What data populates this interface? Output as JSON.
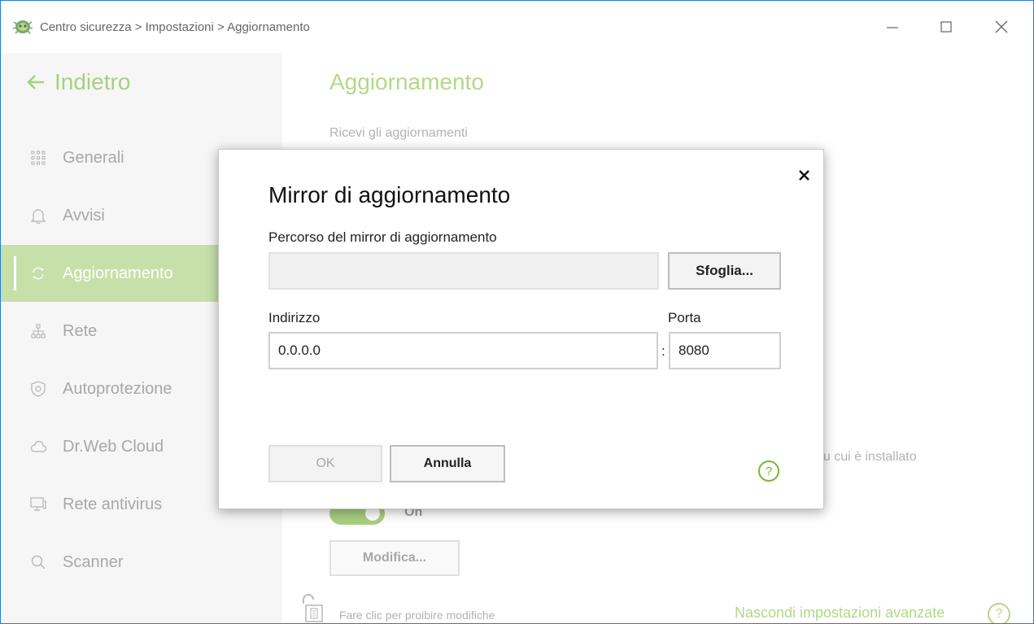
{
  "window": {
    "title": "Centro sicurezza > Impostazioni > Aggiornamento",
    "accent": "#8bc34a"
  },
  "sidebar": {
    "back_label": "Indietro",
    "items": [
      {
        "label": "Generali",
        "icon": "grid-icon"
      },
      {
        "label": "Avvisi",
        "icon": "bell-icon"
      },
      {
        "label": "Aggiornamento",
        "icon": "refresh-icon",
        "active": true
      },
      {
        "label": "Rete",
        "icon": "network-icon"
      },
      {
        "label": "Autoprotezione",
        "icon": "shield-icon"
      },
      {
        "label": "Dr.Web Cloud",
        "icon": "cloud-icon"
      },
      {
        "label": "Rete antivirus",
        "icon": "monitor-icon"
      },
      {
        "label": "Scanner",
        "icon": "search-icon"
      }
    ]
  },
  "main": {
    "title": "Aggiornamento",
    "receive_label": "Ricevi gli aggiornamenti",
    "obscured_text": "le su cui è installato",
    "toggle_label": "On",
    "modify_label": "Modifica...",
    "lock_text": "Fare clic per proibire modifiche",
    "hide_advanced": "Nascondi impostazioni avanzate",
    "help_glyph": "?"
  },
  "dialog": {
    "title": "Mirror di aggiornamento",
    "close_glyph": "×",
    "path_label": "Percorso del mirror di aggiornamento",
    "path_value": "",
    "browse_label": "Sfoglia...",
    "address_label": "Indirizzo",
    "address_value": "0.0.0.0",
    "port_label": "Porta",
    "port_value": "8080",
    "separator": ":",
    "ok_label": "OK",
    "cancel_label": "Annulla",
    "help_glyph": "?"
  }
}
